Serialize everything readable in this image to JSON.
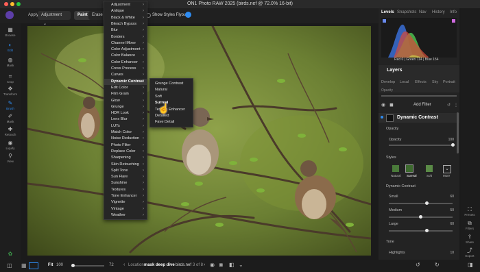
{
  "window": {
    "title": "ON1 Photo RAW 2025 (birds.nef @ 72.0% 16-bit)"
  },
  "toolbar": {
    "apply_label": "Apply",
    "adjustment_label": "Adjustment",
    "paint_label": "Paint",
    "erase_label": "Erase",
    "show_styles_label": "Show Styles Flyout"
  },
  "left_tools": [
    {
      "label": "Browse"
    },
    {
      "label": "Edit"
    },
    {
      "label": "Mask"
    },
    {
      "label": "Crop"
    },
    {
      "label": "Transform"
    },
    {
      "label": "Brush"
    },
    {
      "label": "Mask"
    },
    {
      "label": "Retouch"
    },
    {
      "label": "Liquify"
    },
    {
      "label": "View"
    }
  ],
  "filter_menu": {
    "items": [
      "Adjustment",
      "Antique",
      "Black & White",
      "Bleach Bypass",
      "Blur",
      "Borders",
      "Channel Mixer",
      "Color Adjustment",
      "Color Balance",
      "Color Enhancer",
      "Cross Process",
      "Curves",
      "Dynamic Contrast",
      "Edit Color",
      "Film Grain",
      "Glow",
      "Grunge",
      "HDR Look",
      "Lens Blur",
      "LUTs",
      "Match Color",
      "Noise Reduction",
      "Photo Filter",
      "Replace Color",
      "Sharpening",
      "Skin Retouching",
      "Split Tone",
      "Sun Flare",
      "Sunshine",
      "Textures",
      "Tone Enhancer",
      "Vignette",
      "Vintage",
      "Weather"
    ],
    "selected": "Dynamic Contrast"
  },
  "submenu": {
    "items": [
      "Grunge Contrast",
      "Natural",
      "Soft",
      "Surreal",
      "Texture Enhancer",
      "Detailed",
      "Fave Detail"
    ],
    "selected": "Surreal"
  },
  "right_panel": {
    "tabs": [
      "Levels",
      "Snapshots",
      "Nav",
      "History",
      "Info"
    ],
    "histogram_readout": "Red 0 | Green 114 | Blue 154",
    "layers_title": "Layers",
    "subtabs": [
      "Develop",
      "Local",
      "Effects",
      "Sky",
      "Portrait"
    ],
    "opacity_label": "Opacity",
    "add_filter_label": "Add Filter",
    "filter_title": "Dynamic Contrast",
    "opacity_section": "Opacity",
    "opacity_slider_label": "Opacity",
    "opacity_value": "100",
    "opacity_level": 1.0,
    "styles_label": "Styles",
    "styles": [
      "Natural",
      "Surreal",
      "Soft",
      "More"
    ],
    "dc_section": "Dynamic Contrast",
    "sliders": [
      {
        "label": "Small",
        "value": "60",
        "level": 0.6
      },
      {
        "label": "Medium",
        "value": "50",
        "level": 0.5
      },
      {
        "label": "Large",
        "value": "60",
        "level": 0.6
      }
    ],
    "tone_section": "Tone",
    "highlights_label": "Highlights",
    "highlights_value": "10"
  },
  "far_right": [
    {
      "label": "Presets"
    },
    {
      "label": "Filters"
    },
    {
      "label": "Share"
    },
    {
      "label": "Export"
    }
  ],
  "bottom": {
    "fit_label": "Fit",
    "zoom_value": "100",
    "zoom_level_value": "72",
    "location_label": "Location",
    "location_value": "mask deep dive",
    "file_name": "birds.nef",
    "page_count": "3 of 8"
  },
  "colors": {
    "accent": "#2e8bf0",
    "panel": "#232323"
  }
}
